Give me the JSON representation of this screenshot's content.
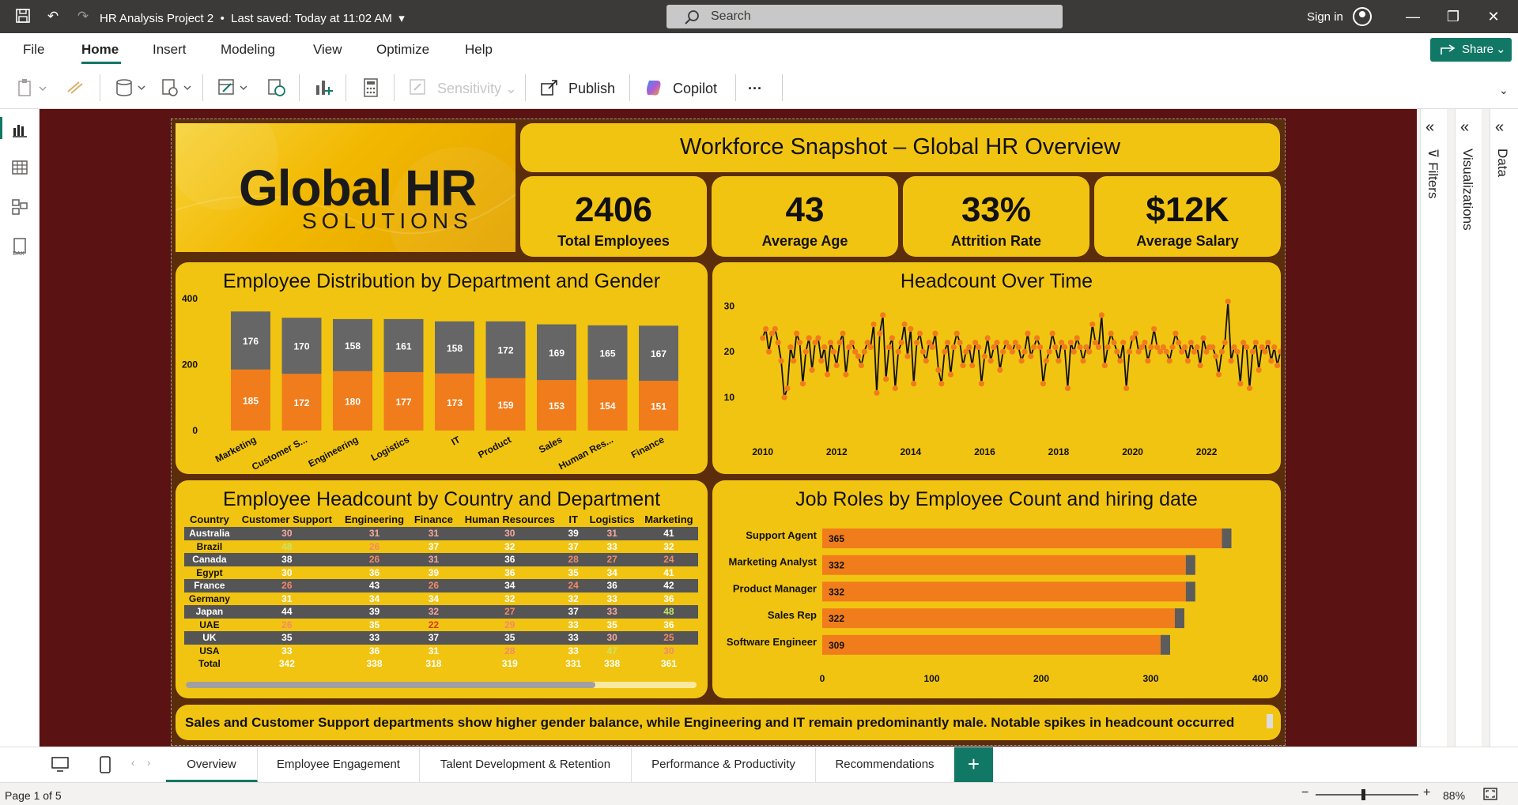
{
  "titlebar": {
    "doc_title": "HR Analysis Project 2",
    "saved": "Last saved: Today at 11:02 AM",
    "search_placeholder": "Search",
    "signin": "Sign in"
  },
  "menu": {
    "items": [
      "File",
      "Home",
      "Insert",
      "Modeling",
      "View",
      "Optimize",
      "Help"
    ],
    "share": "Share"
  },
  "ribbon": {
    "sensitivity": "Sensitivity",
    "publish": "Publish",
    "copilot": "Copilot",
    "more": "···"
  },
  "panels": {
    "filters": "Filters",
    "visualizations": "Visualizations",
    "data": "Data"
  },
  "logo": {
    "main": "Global HR",
    "sub": "SOLUTIONS"
  },
  "header_title": "Workforce Snapshot – Global HR Overview",
  "kpis": [
    {
      "value": "2406",
      "label": "Total Employees"
    },
    {
      "value": "43",
      "label": "Average Age"
    },
    {
      "value": "33%",
      "label": "Attrition Rate"
    },
    {
      "value": "$12K",
      "label": "Average Salary"
    }
  ],
  "dept_chart": {
    "title": "Employee Distribution by Department and Gender",
    "chart_data": {
      "type": "bar",
      "stacked": true,
      "categories": [
        "Marketing",
        "Customer S...",
        "Engineering",
        "Logistics",
        "IT",
        "Product",
        "Sales",
        "Human Res...",
        "Finance"
      ],
      "series": [
        {
          "name": "",
          "color": "#f07c1c",
          "values": [
            185,
            172,
            180,
            177,
            173,
            159,
            153,
            154,
            151
          ]
        },
        {
          "name": "",
          "color": "#666666",
          "values": [
            176,
            170,
            158,
            161,
            158,
            172,
            169,
            165,
            167
          ]
        }
      ],
      "yticks": [
        "0",
        "200",
        "400"
      ],
      "ylim": [
        0,
        400
      ]
    }
  },
  "headcount_chart": {
    "title": "Headcount Over Time",
    "chart_data": {
      "type": "line",
      "xticks": [
        "2010",
        "2012",
        "2014",
        "2016",
        "2018",
        "2020",
        "2022"
      ],
      "yticks": [
        "10",
        "20",
        "30"
      ],
      "ylim": [
        5,
        33
      ],
      "xlim": [
        2009.6,
        2023.6
      ],
      "start_year": 2010,
      "step_year": 0.0833,
      "values": [
        23,
        25,
        20,
        24,
        25,
        22,
        18,
        10,
        12,
        21,
        18,
        24,
        22,
        13,
        20,
        23,
        16,
        22,
        23,
        18,
        21,
        15,
        22,
        20,
        17,
        22,
        24,
        15,
        21,
        22,
        20,
        19,
        17,
        20,
        22,
        21,
        26,
        11,
        24,
        28,
        14,
        21,
        23,
        12,
        20,
        22,
        26,
        19,
        25,
        13,
        22,
        24,
        20,
        18,
        22,
        21,
        24,
        16,
        13,
        20,
        22,
        15,
        21,
        24,
        22,
        17,
        20,
        21,
        17,
        22,
        21,
        13,
        19,
        23,
        18,
        21,
        22,
        16,
        20,
        22,
        21,
        20,
        22,
        21,
        18,
        20,
        24,
        19,
        21,
        23,
        21,
        13,
        18,
        20,
        24,
        21,
        18,
        22,
        21,
        12,
        22,
        20,
        23,
        21,
        18,
        21,
        20,
        26,
        22,
        21,
        28,
        17,
        21,
        24,
        22,
        20,
        18,
        22,
        12,
        20,
        23,
        24,
        20,
        21,
        22,
        18,
        21,
        25,
        21,
        20,
        21,
        20,
        18,
        21,
        24,
        22,
        20,
        21,
        18,
        22,
        20,
        21,
        17,
        23,
        20,
        21,
        21,
        19,
        15,
        20,
        22,
        31,
        18,
        21,
        20,
        13,
        22,
        21,
        12,
        20,
        22,
        16,
        21,
        20,
        22,
        18,
        21,
        17,
        20,
        21,
        22,
        20,
        21,
        22,
        20,
        21,
        13,
        21,
        20,
        22,
        18,
        21,
        19,
        21,
        20,
        21,
        22,
        20,
        21,
        15,
        22,
        20,
        17,
        21,
        23,
        19,
        21
      ]
    }
  },
  "country_table": {
    "title": "Employee Headcount by Country and Department",
    "columns": [
      "Country",
      "Customer Support",
      "Engineering",
      "Finance",
      "Human Resources",
      "IT",
      "Logistics",
      "Marketing"
    ],
    "rows": [
      {
        "c": "Australia",
        "v": [
          "30",
          "31",
          "31",
          "30",
          "39",
          "31",
          "41"
        ],
        "k": [
          "pk",
          "pk",
          "pk",
          "pk",
          "mid",
          "pk",
          "mid"
        ]
      },
      {
        "c": "Brazil",
        "v": [
          "48",
          "26",
          "37",
          "32",
          "37",
          "33",
          "32"
        ],
        "k": [
          "hi",
          "lo",
          "mid",
          "mid",
          "mid",
          "mid",
          "mid"
        ]
      },
      {
        "c": "Canada",
        "v": [
          "38",
          "26",
          "31",
          "36",
          "28",
          "27",
          "24"
        ],
        "k": [
          "mid",
          "lo",
          "pk",
          "mid",
          "lo",
          "lo",
          "lo"
        ]
      },
      {
        "c": "Egypt",
        "v": [
          "30",
          "36",
          "39",
          "36",
          "35",
          "34",
          "41"
        ],
        "k": [
          "mid",
          "mid",
          "mid",
          "mid",
          "mid",
          "mid",
          "mid"
        ]
      },
      {
        "c": "France",
        "v": [
          "26",
          "43",
          "26",
          "34",
          "24",
          "36",
          "42"
        ],
        "k": [
          "lo",
          "mid",
          "lo",
          "mid",
          "lo",
          "mid",
          "mid"
        ]
      },
      {
        "c": "Germany",
        "v": [
          "31",
          "34",
          "34",
          "32",
          "32",
          "33",
          "36"
        ],
        "k": [
          "mid",
          "mid",
          "mid",
          "mid",
          "mid",
          "mid",
          "mid"
        ]
      },
      {
        "c": "Japan",
        "v": [
          "44",
          "39",
          "32",
          "27",
          "37",
          "33",
          "48"
        ],
        "k": [
          "mid",
          "mid",
          "pk",
          "lo",
          "mid",
          "pk",
          "hi"
        ]
      },
      {
        "c": "UAE",
        "v": [
          "26",
          "35",
          "22",
          "29",
          "33",
          "35",
          "36"
        ],
        "k": [
          "lo",
          "mid",
          "vlo",
          "lo",
          "mid",
          "mid",
          "mid"
        ]
      },
      {
        "c": "UK",
        "v": [
          "35",
          "33",
          "37",
          "35",
          "33",
          "30",
          "25"
        ],
        "k": [
          "mid",
          "mid",
          "mid",
          "mid",
          "mid",
          "pk",
          "lo"
        ]
      },
      {
        "c": "USA",
        "v": [
          "33",
          "36",
          "31",
          "28",
          "33",
          "47",
          "30"
        ],
        "k": [
          "mid",
          "mid",
          "mid",
          "lo",
          "mid",
          "hi",
          "lo"
        ]
      }
    ],
    "total_label": "Total",
    "totals": [
      "342",
      "338",
      "318",
      "319",
      "331",
      "338",
      "361"
    ]
  },
  "jobs_chart": {
    "title": "Job Roles by Employee Count and hiring date",
    "chart_data": {
      "type": "bar",
      "orientation": "horizontal",
      "categories": [
        "Support Agent",
        "Marketing Analyst",
        "Product Manager",
        "Sales Rep",
        "Software Engineer"
      ],
      "values": [
        365,
        332,
        332,
        322,
        309
      ],
      "xticks": [
        "0",
        "100",
        "200",
        "300",
        "400"
      ],
      "xlim": [
        0,
        400
      ]
    }
  },
  "insight": "Sales and Customer Support departments show higher gender balance, while Engineering and IT remain predominantly male. Notable spikes in headcount occurred",
  "tabs": [
    "Overview",
    "Employee Engagement",
    "Talent Development & Retention",
    "Performance & Productivity",
    "Recommendations"
  ],
  "status": {
    "page": "Page 1 of 5",
    "zoom": "88%"
  },
  "colors": {
    "accent": "#117865",
    "canvas": "#5a1212",
    "card": "#f2c412",
    "orange": "#f07c1c",
    "gray": "#666666"
  }
}
